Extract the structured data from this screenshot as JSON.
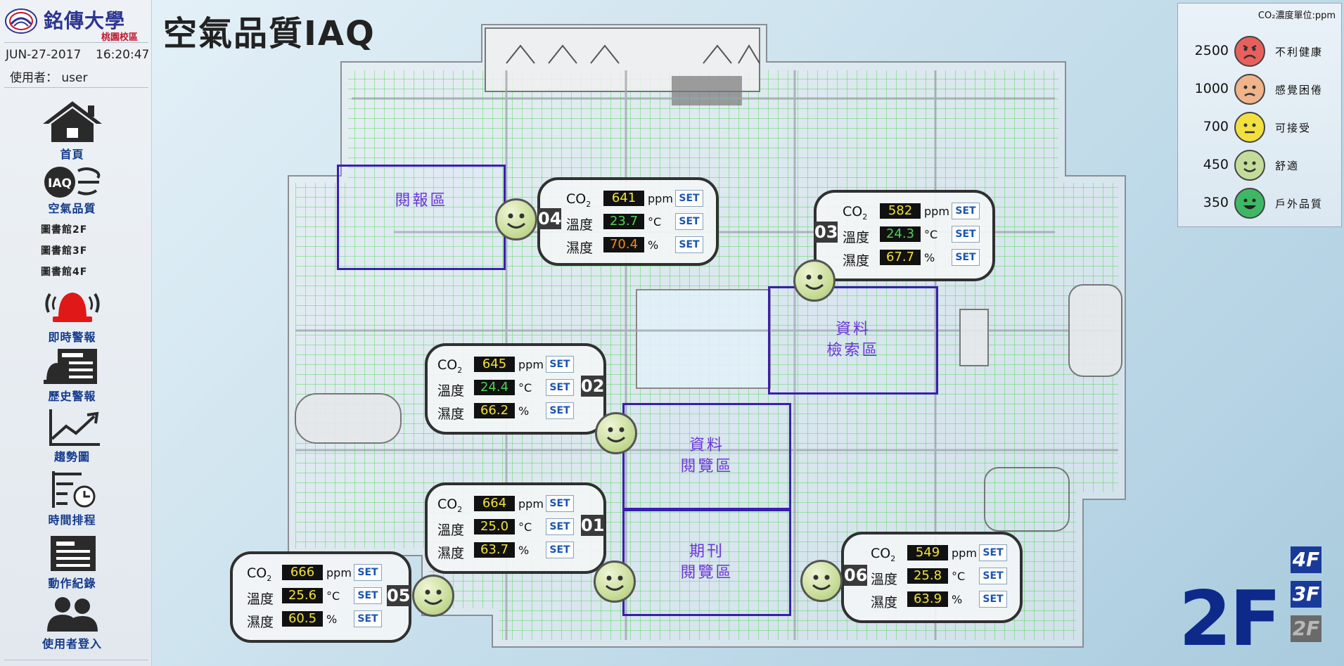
{
  "title": "空氣品質IAQ",
  "brand": {
    "name": "銘傳大學",
    "campus": "桃園校區"
  },
  "header": {
    "date": "JUN-27-2017",
    "time": "16:20:47",
    "user": "使用者： user"
  },
  "nav": {
    "home": "首頁",
    "iaq": "空氣品質",
    "lib2f": "圖書館2F",
    "lib3f": "圖書館3F",
    "lib4f": "圖書館4F",
    "alarm": "即時警報",
    "history": "歷史警報",
    "trend": "趨勢圖",
    "schedule": "時間排程",
    "log": "動作紀錄",
    "login": "使用者登入"
  },
  "labels": {
    "co2": "CO",
    "co2_sub": "2",
    "temp": "溫度",
    "humidity": "濕度",
    "ppm": "ppm",
    "celsius": "°C",
    "percent": "%",
    "set": "SET",
    "iaq_icon": "IAQ"
  },
  "zones": {
    "newspaper": "閱報區",
    "search_l1": "資料",
    "search_l2": "檢索區",
    "reading_l1": "資料",
    "reading_l2": "閱覽區",
    "journal_l1": "期刊",
    "journal_l2": "閱覽區"
  },
  "sensors": {
    "s01": {
      "id": "01",
      "co2": "664",
      "temp": "25.0",
      "hum": "63.7"
    },
    "s02": {
      "id": "02",
      "co2": "645",
      "temp": "24.4",
      "hum": "66.2"
    },
    "s03": {
      "id": "03",
      "co2": "582",
      "temp": "24.3",
      "hum": "67.7"
    },
    "s04": {
      "id": "04",
      "co2": "641",
      "temp": "23.7",
      "hum": "70.4"
    },
    "s05": {
      "id": "05",
      "co2": "666",
      "temp": "25.6",
      "hum": "60.5"
    },
    "s06": {
      "id": "06",
      "co2": "549",
      "temp": "25.8",
      "hum": "63.9"
    }
  },
  "legend": {
    "header": "CO₂濃度單位:ppm",
    "l2500": "2500",
    "t2500": "不利健康",
    "l1000": "1000",
    "t1000": "感覺困倦",
    "l700": "700",
    "t700": "可接受",
    "l450": "450",
    "t450": "舒適",
    "l350": "350",
    "t350": "戶外品質"
  },
  "floors": {
    "current": "2F",
    "btn4": "4F",
    "btn3": "3F",
    "btn2": "2F"
  },
  "colors": {
    "accent": "#143a8c",
    "co2_value": "#f2e23a",
    "temp_value": "#4fd24f",
    "hum_value": "#f2e23a",
    "hum_warn": "#f08a18",
    "face_bad": "#e8605c",
    "face_tired": "#f0b38a",
    "face_ok": "#f2e040",
    "face_good": "#c4dc9a",
    "face_outdoor": "#3fb865"
  }
}
